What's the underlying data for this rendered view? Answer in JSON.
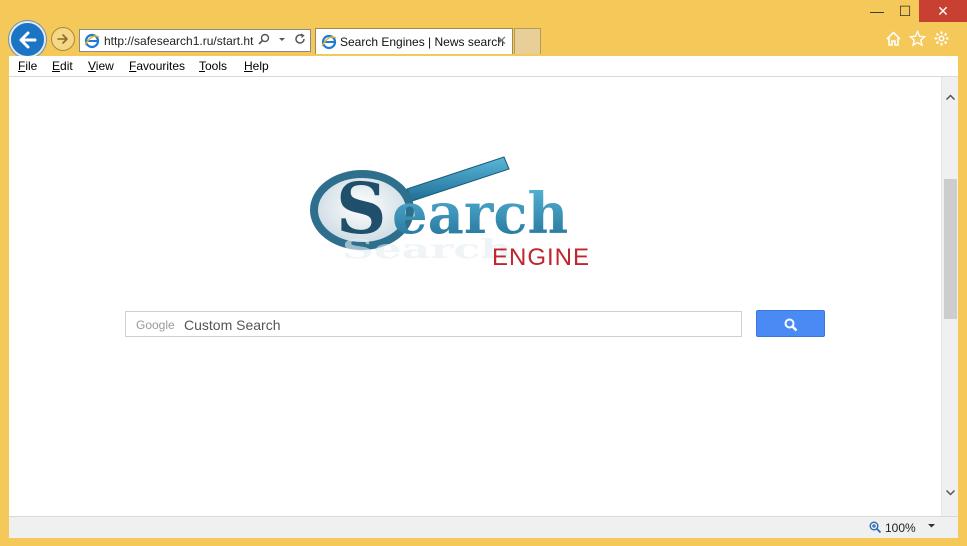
{
  "browser": {
    "url": "http://safesearch1.ru/start.ht",
    "tab_title": "Search Engines | News search",
    "close_tab": "✕",
    "window": {
      "minimize": "—",
      "maximize": "☐",
      "close": "✕"
    }
  },
  "menu": {
    "file": "File",
    "edit": "Edit",
    "view": "View",
    "favourites": "Favourites",
    "tools": "Tools",
    "help": "Help"
  },
  "page": {
    "logo_word": "Search",
    "logo_sub": "ENGINE",
    "search": {
      "brand": "Google",
      "placeholder": "Custom Search"
    }
  },
  "status": {
    "zoom": "100%"
  },
  "colors": {
    "frame": "#f4c859",
    "accent": "#1c74c4",
    "search_button": "#4a8af4",
    "logo_blue": "#2a86b0",
    "logo_red": "#c0262e"
  },
  "icons": [
    "back-arrow-icon",
    "forward-arrow-icon",
    "ie-logo-icon",
    "search-icon",
    "dropdown-icon",
    "refresh-icon",
    "home-icon",
    "star-icon",
    "gear-icon",
    "zoom-icon"
  ]
}
